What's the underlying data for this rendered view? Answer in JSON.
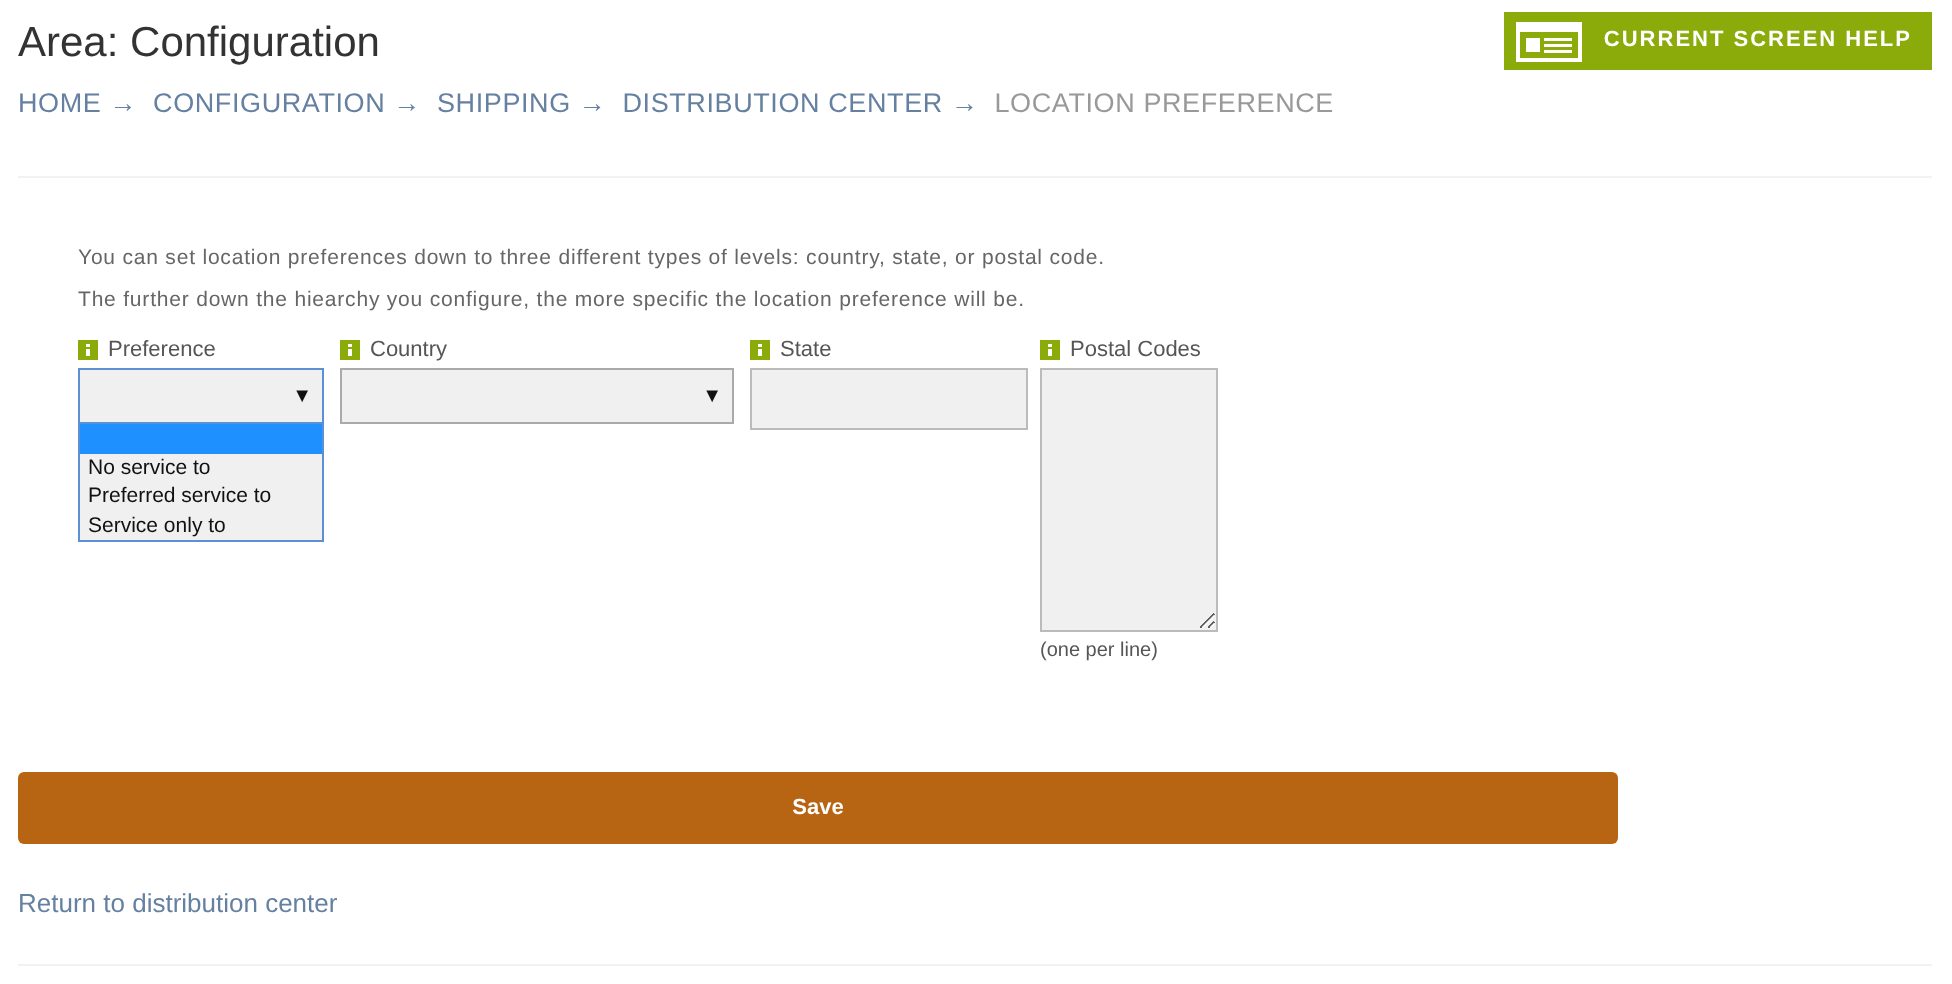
{
  "header": {
    "title": "Area: Configuration",
    "help_button": "CURRENT SCREEN HELP"
  },
  "breadcrumb": [
    {
      "label": "HOME",
      "arrow": "→",
      "current": false
    },
    {
      "label": "CONFIGURATION",
      "arrow": "→",
      "current": false
    },
    {
      "label": "SHIPPING",
      "arrow": "→",
      "current": false
    },
    {
      "label": "DISTRIBUTION CENTER",
      "arrow": "→",
      "current": false
    },
    {
      "label": "LOCATION PREFERENCE",
      "current": true
    }
  ],
  "intro": [
    "You can set location preferences down to three different types of levels: country, state, or postal code.",
    "The further down the hiearchy you configure, the more specific the location preference will be."
  ],
  "fields": [
    {
      "kind": "select",
      "label": "Preference",
      "arrow": "▼",
      "expanded": true,
      "options": [
        {
          "selected": true
        },
        {
          "label": "No service to",
          "selected": false
        },
        {
          "label": "Preferred service to",
          "selected": false
        },
        {
          "label": "Service only to",
          "selected": false
        }
      ]
    },
    {
      "kind": "select",
      "label": "Country",
      "arrow": "▼",
      "expanded": false
    },
    {
      "kind": "text",
      "label": "State"
    },
    {
      "kind": "textarea",
      "label": "Postal Codes",
      "hint": "(one per line)"
    }
  ],
  "save_button": "Save",
  "return_link": "Return to distribution center"
}
